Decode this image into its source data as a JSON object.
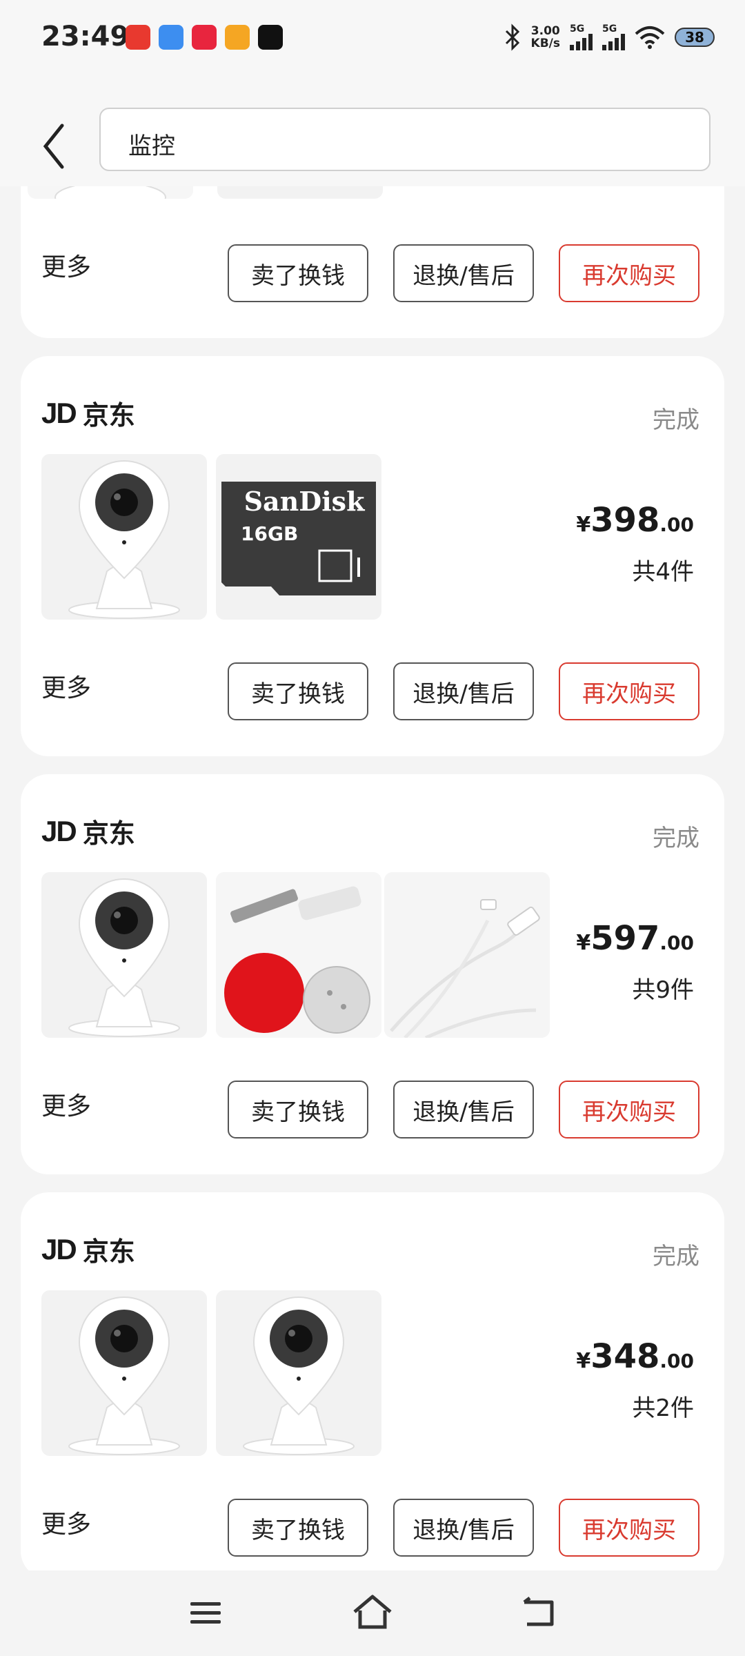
{
  "status_bar": {
    "time": "23:49",
    "speed_value": "3.00",
    "speed_unit": "KB/s",
    "signal1": "5G",
    "signal2": "5G",
    "battery": "38"
  },
  "header": {
    "search_value": "监控"
  },
  "orders": [
    {
      "buttons": [
        "卖了换钱",
        "退换/售后",
        "再次购买"
      ],
      "more": "更多"
    },
    {
      "brand_logo": "JD",
      "brand": "京东",
      "status": "完成",
      "sandisk_label": "SanDisk",
      "sandisk_capacity": "16GB",
      "price_symbol": "¥",
      "price_int": "398",
      "price_dec": ".00",
      "count": "共4件",
      "more": "更多",
      "buttons": [
        "卖了换钱",
        "退换/售后",
        "再次购买"
      ]
    },
    {
      "brand_logo": "JD",
      "brand": "京东",
      "status": "完成",
      "price_symbol": "¥",
      "price_int": "597",
      "price_dec": ".00",
      "count": "共9件",
      "more": "更多",
      "buttons": [
        "卖了换钱",
        "退换/售后",
        "再次购买"
      ]
    },
    {
      "brand_logo": "JD",
      "brand": "京东",
      "status": "完成",
      "price_symbol": "¥",
      "price_int": "348",
      "price_dec": ".00",
      "count": "共2件",
      "more": "更多",
      "buttons": [
        "卖了换钱",
        "退换/售后",
        "再次购买"
      ]
    }
  ],
  "icons": {
    "back": "chevron-left-icon",
    "bluetooth": "bluetooth-icon",
    "wifi": "wifi-icon",
    "nav_menu": "menu-icon",
    "nav_home": "home-icon",
    "nav_back": "back-icon"
  },
  "colors": {
    "accent_red": "#d93a2f",
    "background": "#f4f4f4",
    "card": "#ffffff"
  }
}
